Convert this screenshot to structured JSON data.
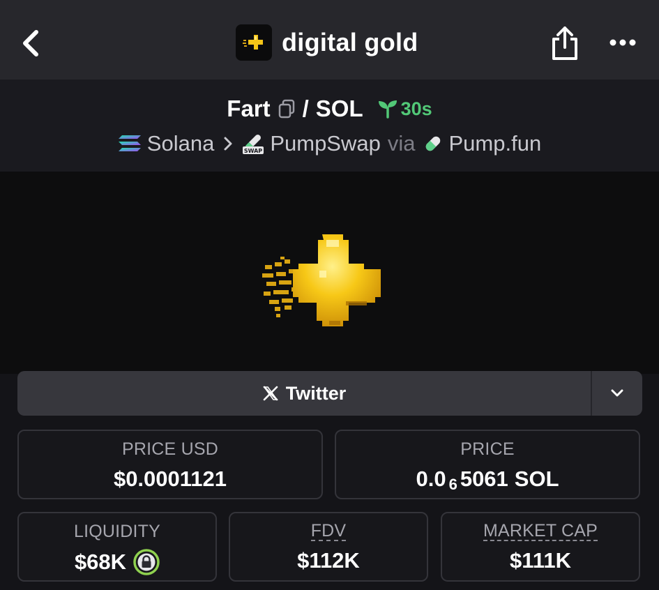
{
  "header": {
    "title": "digital gold",
    "icons": {
      "back": "chevron-left-icon",
      "share": "share-icon",
      "more": "more-horizontal-icon"
    }
  },
  "pair": {
    "base": "Fart",
    "separator": "/",
    "quote": "SOL",
    "age": "30s",
    "chain": "Solana",
    "dex": "PumpSwap",
    "via": "via",
    "launchpad": "Pump.fun"
  },
  "links": {
    "twitter_label": "Twitter"
  },
  "stats": {
    "price_usd": {
      "label": "PRICE USD",
      "value": "$0.0001121"
    },
    "price": {
      "label": "PRICE",
      "prefix": "0.0",
      "zeros": "6",
      "digits": "5061",
      "unit": "SOL"
    },
    "liquidity": {
      "label": "LIQUIDITY",
      "value": "$68K"
    },
    "fdv": {
      "label": "FDV",
      "value": "$112K"
    },
    "market_cap": {
      "label": "MARKET CAP",
      "value": "$111K"
    }
  },
  "colors": {
    "age_green": "#52c877",
    "lock_green": "#8fd14f",
    "gold": "#f5c518"
  }
}
